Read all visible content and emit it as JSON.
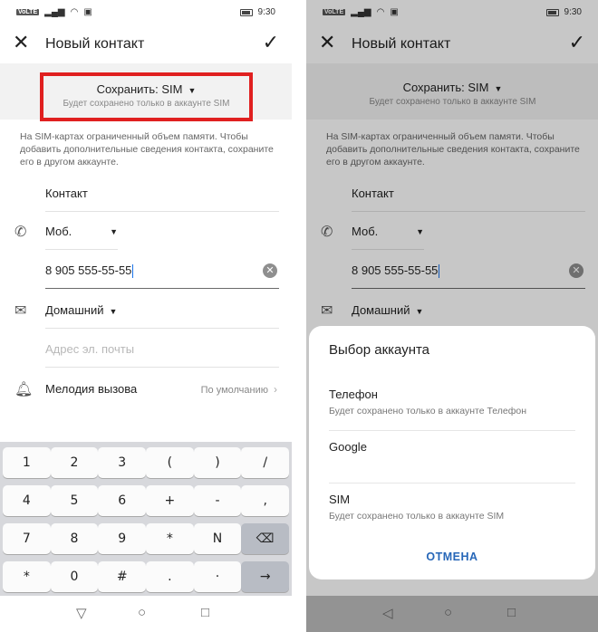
{
  "statusbar": {
    "carrier_badge": "VoLTE",
    "time": "9:30"
  },
  "header": {
    "title": "Новый контакт"
  },
  "save_to": {
    "label": "Сохранить: SIM",
    "sublabel": "Будет сохранено только в аккаунте SIM"
  },
  "info_text": "На SIM-картах ограниченный объем памяти. Чтобы добавить дополнительные сведения контакта, сохраните его в другом аккаунте.",
  "form": {
    "name_label": "Контакт",
    "phone_type": "Моб.",
    "phone_value": "8 905 555-55-55",
    "email_type": "Домашний",
    "email_placeholder": "Адрес эл. почты",
    "ringtone_label": "Мелодия вызова",
    "ringtone_value": "По умолчанию"
  },
  "keyboard": {
    "rows": [
      [
        "1",
        "2",
        "3",
        "(",
        ")",
        "/"
      ],
      [
        "4",
        "5",
        "6",
        "+",
        "-",
        ","
      ],
      [
        "7",
        "8",
        "9",
        "*",
        "N",
        "⌫"
      ],
      [
        "*",
        "0",
        "#",
        ".",
        "·",
        "→"
      ]
    ]
  },
  "account_sheet": {
    "title": "Выбор аккаунта",
    "options": [
      {
        "name": "Телефон",
        "desc": "Будет сохранено только в аккаунте Телефон"
      },
      {
        "name": "Google",
        "desc": ""
      },
      {
        "name": "SIM",
        "desc": "Будет сохранено только в аккаунте SIM"
      }
    ],
    "cancel_label": "ОТМЕНА"
  },
  "colors": {
    "highlight": "#e02020",
    "accent": "#2767b8"
  }
}
